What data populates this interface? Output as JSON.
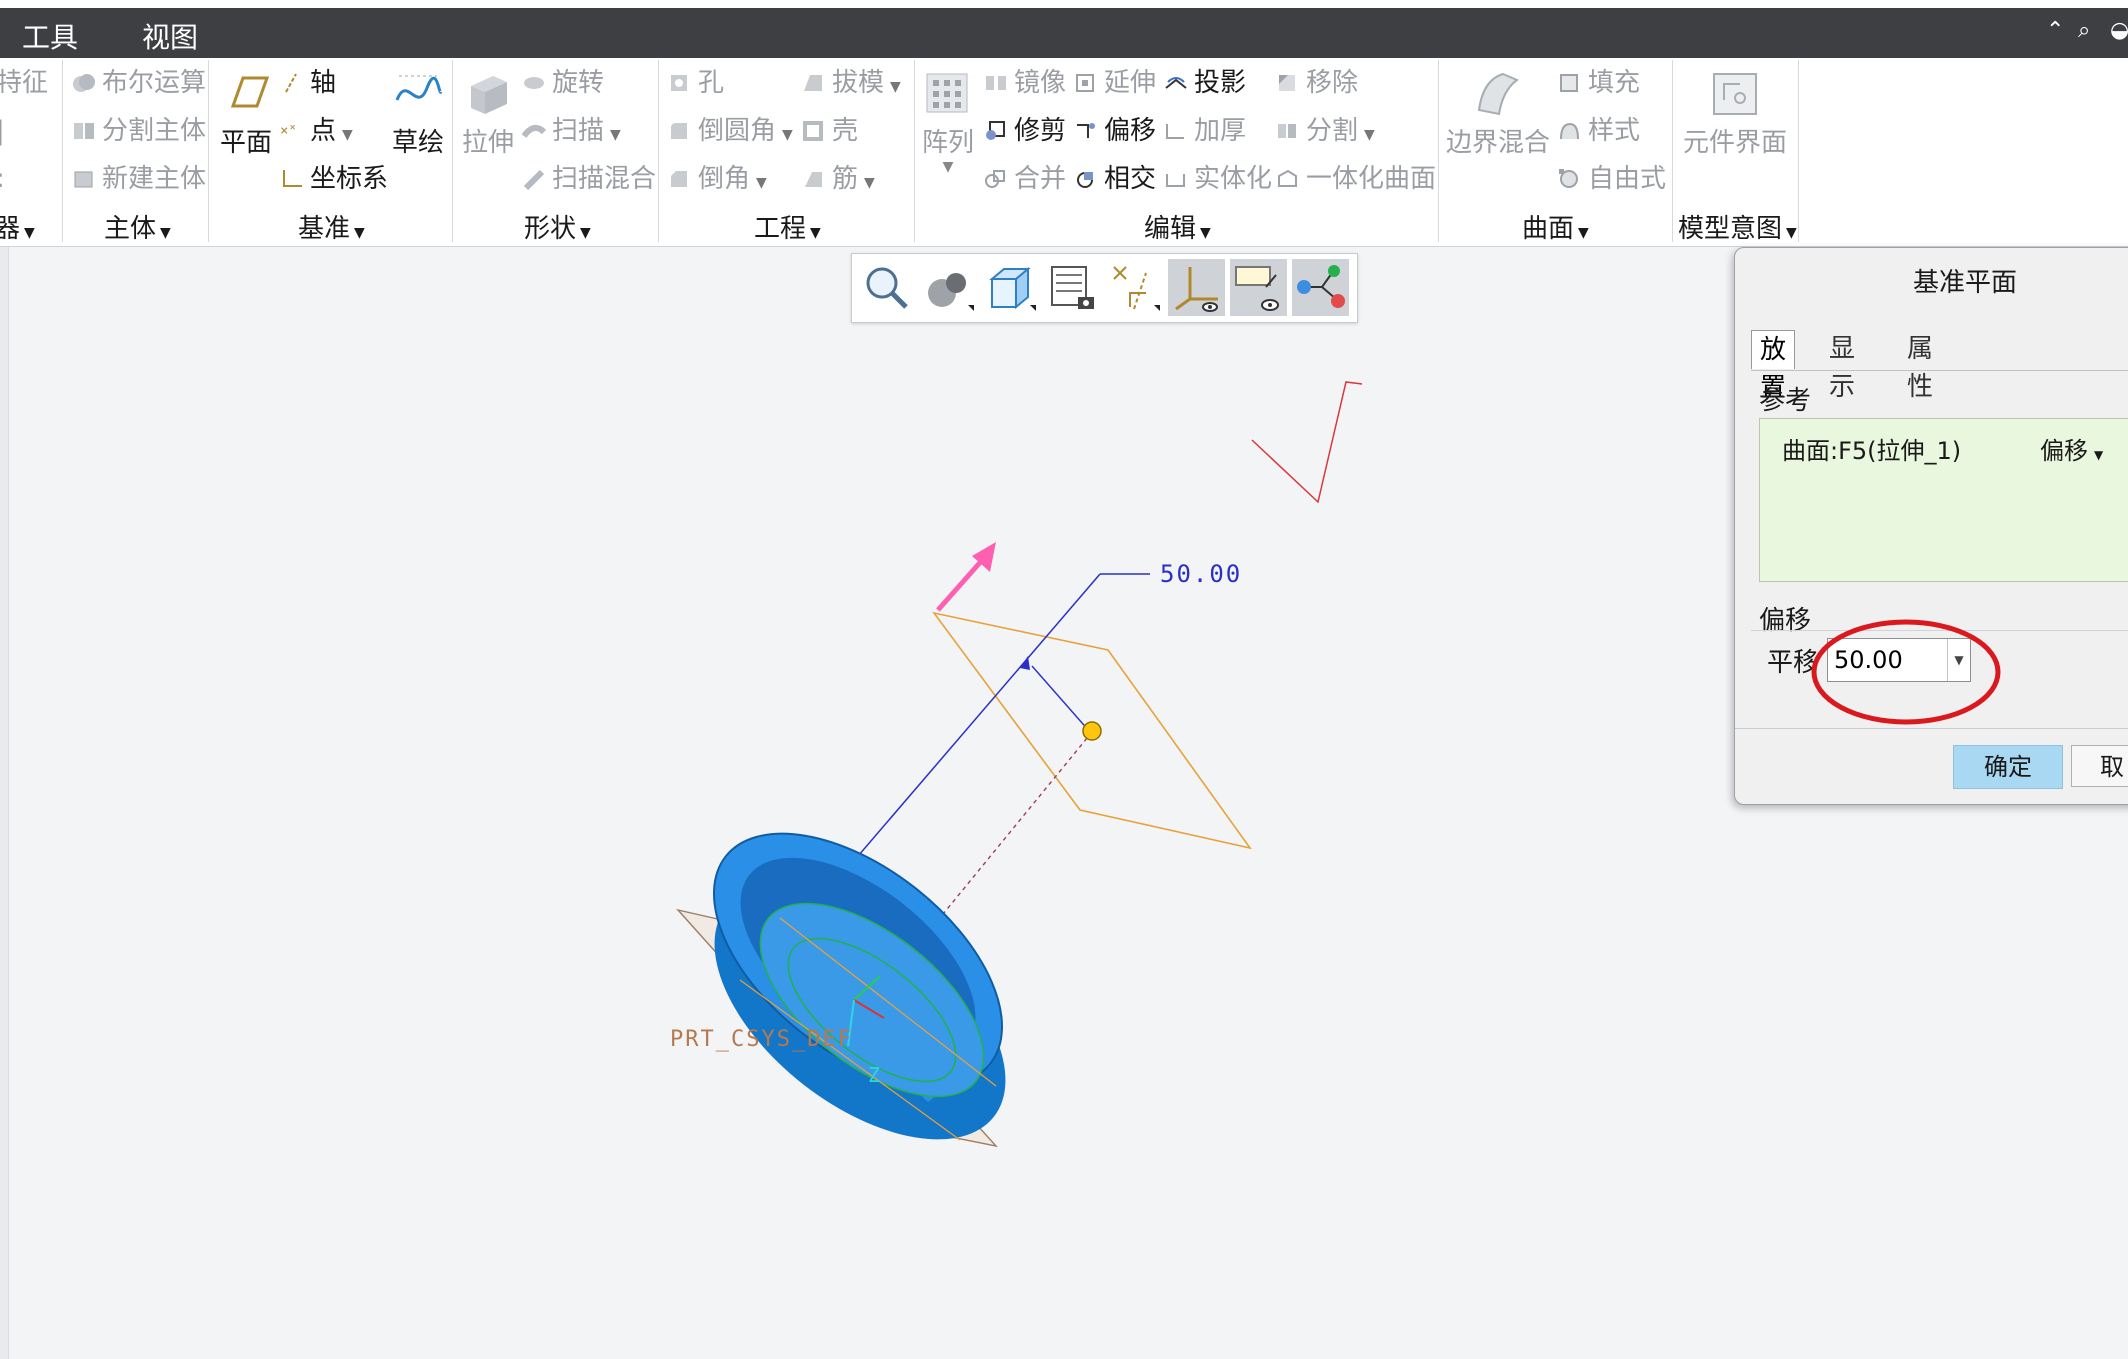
{
  "menu": {
    "tools": "工具",
    "view": "视图"
  },
  "ribbon": {
    "col0": [
      "特征",
      "",
      ""
    ],
    "col_body": {
      "boolean": "布尔运算",
      "split": "分割主体",
      "new_body": "新建主体"
    },
    "col_datum": {
      "plane": "平面",
      "axis": "轴",
      "point": "点",
      "csys": "坐标系",
      "sketch": "草绘"
    },
    "col_shape": {
      "extrude": "拉伸",
      "revolve": "旋转",
      "sweep": "扫描",
      "swept_blend": "扫描混合"
    },
    "col_eng": {
      "hole": "孔",
      "round": "倒圆角",
      "chamfer": "倒角",
      "draft": "拔模",
      "shell": "壳",
      "rib": "筋"
    },
    "col_edit": {
      "pattern": "阵列",
      "mirror": "镜像",
      "trim": "修剪",
      "merge": "合并",
      "extend": "延伸",
      "offset": "偏移",
      "intersect": "相交",
      "project": "投影",
      "thicken": "加厚",
      "solidify": "实体化",
      "remove": "移除",
      "split": "分割",
      "unify": "一体化曲面"
    },
    "col_surface": {
      "boundary_blend": "边界混合",
      "fill": "填充",
      "style": "样式",
      "freestyle": "自由式"
    },
    "col_intent": {
      "component_interface": "元件界面"
    },
    "groups": {
      "g0": "器",
      "body": "主体",
      "datum": "基准",
      "shape": "形状",
      "engineering": "工程",
      "edit": "编辑",
      "surface": "曲面",
      "intent": "模型意图"
    }
  },
  "viewport": {
    "dimension_label": "50.00",
    "csys_label": "PRT_CSYS_DEF",
    "axis_z": "Z"
  },
  "dialog": {
    "title": "基准平面",
    "tabs": [
      "放置",
      "显示",
      "属性"
    ],
    "references_label": "参考",
    "reference_item": "曲面:F5(拉伸_1)",
    "reference_mode": "偏移",
    "offset_label": "偏移",
    "translate_label": "平移",
    "translate_value": "50.00",
    "ok": "确定",
    "cancel": "取"
  },
  "colors": {
    "accent_blue": "#2f6fc8",
    "part_blue": "#1e8ae0",
    "plane_orange": "#e8a23a",
    "highlight_red": "#d9191e"
  }
}
